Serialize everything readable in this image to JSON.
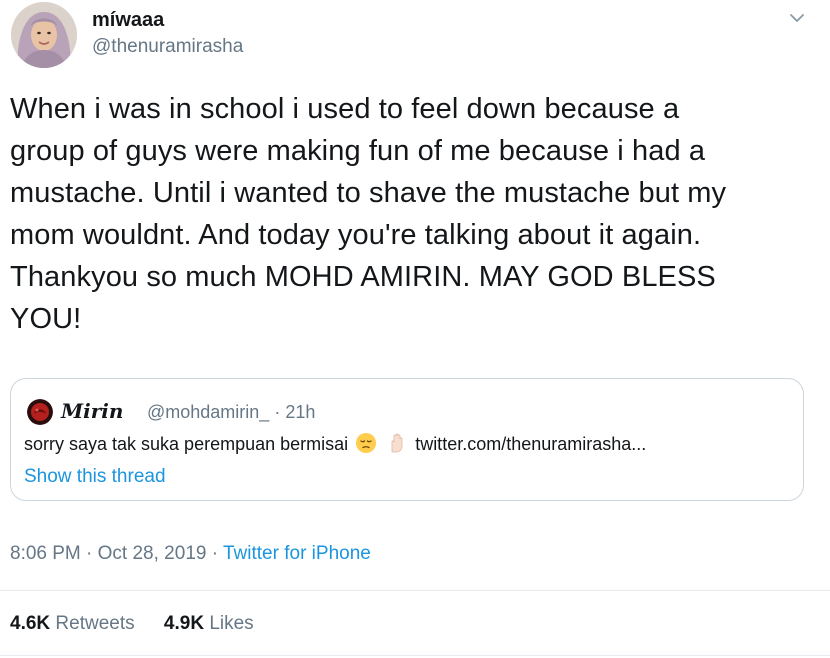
{
  "author": {
    "display_name": "míwaaa",
    "handle": "@thenuramirasha",
    "avatar_icon": "profile-photo"
  },
  "tweet": {
    "text": "When i was in school i used to feel down because a\ngroup of guys were making fun of me because i had a\nmustache. Until i wanted to shave the mustache but my\nmom wouldnt. And today you're talking about it again.\nThankyou so much MOHD AMIRIN. MAY GOD BLESS\nYOU!"
  },
  "quote": {
    "display_name": "Mirin",
    "handle": "@mohdamirin_",
    "separator": "·",
    "age": "21h",
    "text": "sorry saya tak suka perempuan bermisai",
    "emojis": [
      "pensive-face",
      "raised-hand"
    ],
    "link": "twitter.com/thenuramirasha...",
    "show_thread": "Show this thread"
  },
  "meta": {
    "time": "8:06 PM",
    "date": "Oct 28, 2019",
    "separator": "·",
    "source": "Twitter for iPhone"
  },
  "stats": {
    "retweets_count": "4.6K",
    "retweets_label": "Retweets",
    "likes_count": "4.9K",
    "likes_label": "Likes"
  },
  "colors": {
    "text": "#14171a",
    "secondary": "#657786",
    "link": "#1b95e0",
    "border": "#ccd6dd"
  }
}
